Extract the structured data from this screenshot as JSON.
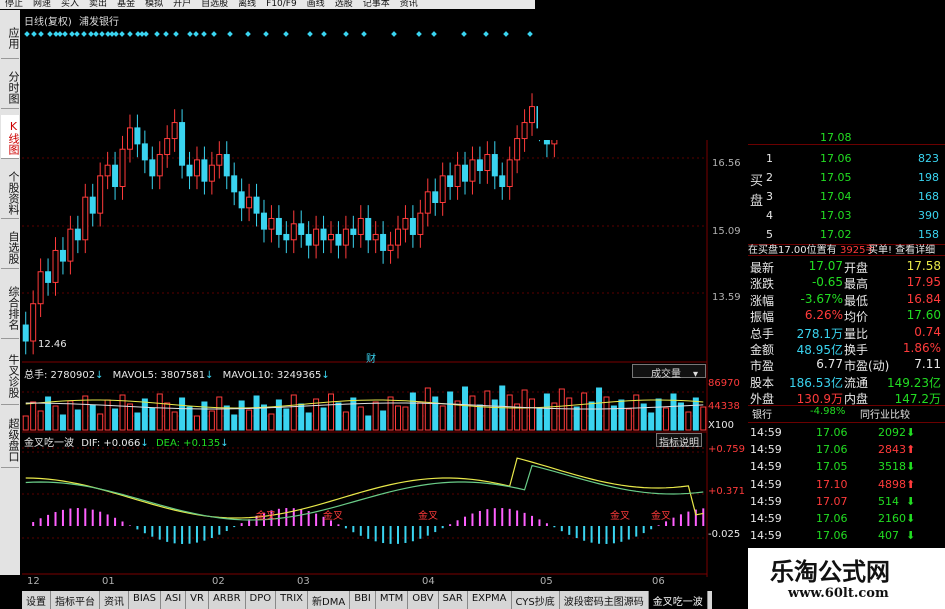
{
  "toolbar": {
    "items": [
      "停止",
      "网速",
      "买入",
      "卖出",
      "基金",
      "模拟",
      "开户",
      "自选股",
      "离线",
      "F10/F9",
      "画线",
      "选股",
      "记事本",
      "资讯"
    ]
  },
  "left_tabs": [
    {
      "label": "应用",
      "active": false
    },
    {
      "label": "分时图",
      "active": false
    },
    {
      "label": "K线图",
      "active": true
    },
    {
      "label": "个股资料",
      "active": false
    },
    {
      "label": "自选股",
      "active": false
    },
    {
      "label": "综合排名",
      "active": false
    },
    {
      "label": "牛叉诊股",
      "active": false
    },
    {
      "label": "超级盘口",
      "active": false
    }
  ],
  "chart_header": {
    "period": "日线(复权)",
    "stock": "浦发银行"
  },
  "price_axis": {
    "labels": [
      "16.56",
      "15.09",
      "13.59"
    ],
    "low_marker": "12.46"
  },
  "financial_marker": "财",
  "volume_header": {
    "total": "总手: 2780902",
    "ma5": "MAVOL5: 3807581",
    "ma10": "MAVOL10: 3249365",
    "dropdown": "成交量",
    "axis": [
      "86970",
      "44338",
      "X100"
    ]
  },
  "macd_header": {
    "name": "金叉吃一波",
    "dif": "DIF: +0.066",
    "dea": "DEA: +0.135",
    "help": "指标说明",
    "axis": [
      "+0.759",
      "+0.371",
      "-0.025"
    ],
    "signals": [
      "金叉",
      "金叉",
      "金叉",
      "金叉",
      "金叉"
    ]
  },
  "x_axis": [
    "12",
    "01",
    "02",
    "03",
    "04",
    "05",
    "06"
  ],
  "order_book": {
    "top_partial": "17.08",
    "side_label": "买盘",
    "rows": [
      {
        "lvl": "1",
        "price": "17.06",
        "vol": "823"
      },
      {
        "lvl": "2",
        "price": "17.05",
        "vol": "198"
      },
      {
        "lvl": "3",
        "price": "17.04",
        "vol": "168"
      },
      {
        "lvl": "4",
        "price": "17.03",
        "vol": "390"
      },
      {
        "lvl": "5",
        "price": "17.02",
        "vol": "158"
      }
    ],
    "info": {
      "left": "在买盘17.00位置有",
      "qty": "3925手",
      "right": "买单!  查看详细"
    }
  },
  "quote": [
    {
      "k1": "最新",
      "v1": "17.07",
      "k2": "开盘",
      "v2": "17.58"
    },
    {
      "k1": "涨跌",
      "v1": "-0.65",
      "k2": "最高",
      "v2": "17.95"
    },
    {
      "k1": "涨幅",
      "v1": "-3.67%",
      "k2": "最低",
      "v2": "16.84"
    },
    {
      "k1": "振幅",
      "v1": "6.26%",
      "k2": "均价",
      "v2": "17.60"
    },
    {
      "k1": "总手",
      "v1": "278.1万",
      "k2": "量比",
      "v2": "0.74"
    },
    {
      "k1": "金额",
      "v1": "48.95亿",
      "k2": "换手",
      "v2": "1.86%"
    },
    {
      "k1": "市盈",
      "v1": "6.77",
      "k2": "市盈(动)",
      "v2": "7.11"
    },
    {
      "k1": "股本",
      "v1": "186.53亿",
      "k2": "流通",
      "v2": "149.23亿"
    },
    {
      "k1": "外盘",
      "v1": "130.9万",
      "k2": "内盘",
      "v2": "147.2万"
    }
  ],
  "industry": {
    "name": "银行",
    "change": "-4.98%",
    "compare": "同行业比较"
  },
  "ticks": [
    {
      "t": "14:59",
      "p": "17.06",
      "v": "2092",
      "d": "down"
    },
    {
      "t": "14:59",
      "p": "17.06",
      "v": "2843",
      "d": "up"
    },
    {
      "t": "14:59",
      "p": "17.05",
      "v": "3518",
      "d": "down"
    },
    {
      "t": "14:59",
      "p": "17.10",
      "v": "4898",
      "d": "up"
    },
    {
      "t": "14:59",
      "p": "17.07",
      "v": "514",
      "d": "down"
    },
    {
      "t": "14:59",
      "p": "17.06",
      "v": "2160",
      "d": "down"
    },
    {
      "t": "14:59",
      "p": "17.06",
      "v": "407",
      "d": "down"
    }
  ],
  "bottom_tabs": [
    "设置",
    "指标平台",
    "资讯",
    "BIAS",
    "ASI",
    "VR",
    "ARBR",
    "DPO",
    "TRIX",
    "新DMA",
    "BBI",
    "MTM",
    "OBV",
    "SAR",
    "EXPMA",
    "CYS抄底",
    "波段密码主图源码",
    "金叉吃一波"
  ],
  "watermark": {
    "title": "乐淘公式网",
    "url": "www.60lt.com"
  },
  "colors": {
    "up": "#ff3b3b",
    "down": "#3ad4f0",
    "bg": "#000000",
    "grid": "#6b0000"
  },
  "chart_data": {
    "type": "candlestick",
    "x_ticks": [
      "12",
      "01",
      "02",
      "03",
      "04",
      "05",
      "06"
    ],
    "ylim": [
      12.2,
      18.3
    ],
    "series_close": [
      12.5,
      13.2,
      13.8,
      13.6,
      14.2,
      14.0,
      14.6,
      14.4,
      15.2,
      14.9,
      15.6,
      15.8,
      15.4,
      16.1,
      16.5,
      16.2,
      15.9,
      15.6,
      16.0,
      16.3,
      16.6,
      15.8,
      15.6,
      15.9,
      15.5,
      15.8,
      16.0,
      15.6,
      15.3,
      15.0,
      15.2,
      14.9,
      14.6,
      14.8,
      14.5,
      14.4,
      14.7,
      14.5,
      14.3,
      14.6,
      14.4,
      14.5,
      14.3,
      14.6,
      14.5,
      14.8,
      14.4,
      14.5,
      14.2,
      14.3,
      14.6,
      14.8,
      14.5,
      14.9,
      15.3,
      15.1,
      15.6,
      15.4,
      15.8,
      15.5,
      15.9,
      15.7,
      16.0,
      15.6,
      15.4,
      15.9,
      16.3,
      16.6,
      16.9,
      16.5,
      16.2,
      16.8,
      17.4,
      17.8,
      17.5,
      18.0,
      17.6,
      17.3,
      17.8,
      17.5,
      17.1,
      17.6,
      18.0,
      17.9,
      17.4,
      17.2,
      17.6,
      17.4,
      17.0,
      17.3,
      16.9,
      17.1
    ]
  }
}
